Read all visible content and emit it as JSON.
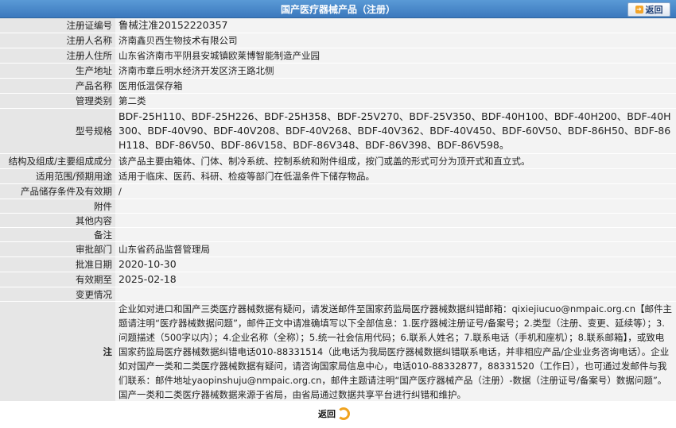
{
  "header": {
    "title": "国产医疗器械产品（注册）",
    "back_label": "返回"
  },
  "fields": [
    {
      "label": "注册证编号",
      "value": "鲁械注准20152220357"
    },
    {
      "label": "注册人名称",
      "value": "济南鑫贝西生物技术有限公司"
    },
    {
      "label": "注册人住所",
      "value": "山东省济南市平阴县安城镇欧莱博智能制造产业园"
    },
    {
      "label": "生产地址",
      "value": "济南市章丘明水经济开发区济王路北侧"
    },
    {
      "label": "产品名称",
      "value": "医用低温保存箱"
    },
    {
      "label": "管理类别",
      "value": "第二类"
    },
    {
      "label": "型号规格",
      "value": "BDF-25H110、BDF-25H226、BDF-25H358、BDF-25V270、BDF-25V350、BDF-40H100、BDF-40H200、BDF-40H300、BDF-40V90、BDF-40V208、BDF-40V268、BDF-40V362、BDF-40V450、BDF-60V50、BDF-86H50、BDF-86H118、BDF-86V50、BDF-86V158、BDF-86V348、BDF-86V398、BDF-86V598。"
    },
    {
      "label": "结构及组成/主要组成成分",
      "value": "该产品主要由箱体、门体、制冷系统、控制系统和附件组成，按门或盖的形式可分为顶开式和直立式。"
    },
    {
      "label": "适用范围/预期用途",
      "value": "适用于临床、医药、科研、检疫等部门在低温条件下储存物品。"
    },
    {
      "label": "产品储存条件及有效期",
      "value": "/"
    },
    {
      "label": "附件",
      "value": ""
    },
    {
      "label": "其他内容",
      "value": ""
    },
    {
      "label": "备注",
      "value": ""
    },
    {
      "label": "审批部门",
      "value": "山东省药品监督管理局"
    },
    {
      "label": "批准日期",
      "value": "2020-10-30"
    },
    {
      "label": "有效期至",
      "value": "2025-02-18"
    },
    {
      "label": "变更情况",
      "value": ""
    }
  ],
  "note": {
    "label": "注",
    "text": "企业如对进口和国产三类医疗器械数据有疑问，请发送邮件至国家药监局医疗器械数据纠错邮箱：qixiejiucuo@nmpaic.org.cn【邮件主题请注明“医疗器械数据问题”，邮件正文中请准确填写以下全部信息：1.医疗器械注册证号/备案号；2.类型（注册、变更、延续等）；3.问题描述（500字以内）；4.企业名称（全称）；5.统一社会信用代码；6.联系人姓名；7.联系电话（手机和座机）；8.联系邮箱】，或致电国家药监局医疗器械数据纠错电话010-88331514（此电话为我局医疗器械数据纠错联系电话，并非相应产品/企业业务咨询电话）。企业如对国产一类和二类医疗器械数据有疑问，请咨询国家局信息中心，电话010-88332877，88331520（工作日），也可通过发邮件与我们联系：邮件地址yaopinshuju@nmpaic.org.cn，邮件主题请注明“国产医疗器械产品（注册）-数据（注册证号/备案号）数据问题”。国产一类和二类医疗器械数据来源于省局，由省局通过数据共享平台进行纠错和维护。"
  },
  "footer": {
    "back_label": "返回"
  }
}
